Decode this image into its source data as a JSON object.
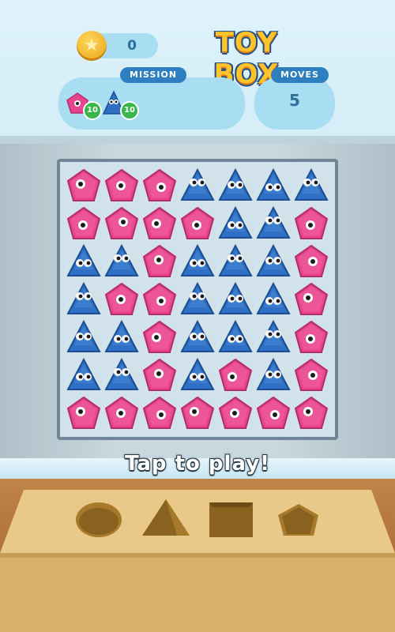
{
  "header": {
    "coins": "0",
    "title": "TOY BOX",
    "mission_label": "MISSION",
    "moves_label": "MOVES",
    "moves_value": "5",
    "mission_goals": [
      {
        "shape": "pentagon",
        "count": "10"
      },
      {
        "shape": "triangle",
        "count": "10"
      }
    ]
  },
  "board": {
    "rows": 7,
    "cols": 7,
    "pieces": [
      [
        "pentagon",
        "pentagon",
        "pentagon",
        "triangle",
        "triangle",
        "triangle",
        "triangle"
      ],
      [
        "pentagon",
        "pentagon",
        "pentagon",
        "pentagon",
        "triangle",
        "triangle",
        "pentagon"
      ],
      [
        "triangle",
        "triangle",
        "pentagon",
        "triangle",
        "triangle",
        "triangle",
        "pentagon"
      ],
      [
        "triangle",
        "pentagon",
        "pentagon",
        "triangle",
        "triangle",
        "triangle",
        "pentagon"
      ],
      [
        "triangle",
        "triangle",
        "pentagon",
        "triangle",
        "triangle",
        "triangle",
        "pentagon"
      ],
      [
        "triangle",
        "triangle",
        "pentagon",
        "triangle",
        "pentagon",
        "triangle",
        "pentagon"
      ],
      [
        "pentagon",
        "pentagon",
        "pentagon",
        "pentagon",
        "pentagon",
        "pentagon",
        "pentagon"
      ]
    ]
  },
  "prompt": "Tap to play!",
  "shape_sorter": [
    "circle-hole",
    "triangle-hole",
    "square-hole",
    "pentagon-hole"
  ],
  "colors": {
    "pentagon": "#e8458f",
    "triangle": "#2f6fc4",
    "accent": "#2e7fc0",
    "badge": "#39b54a"
  }
}
